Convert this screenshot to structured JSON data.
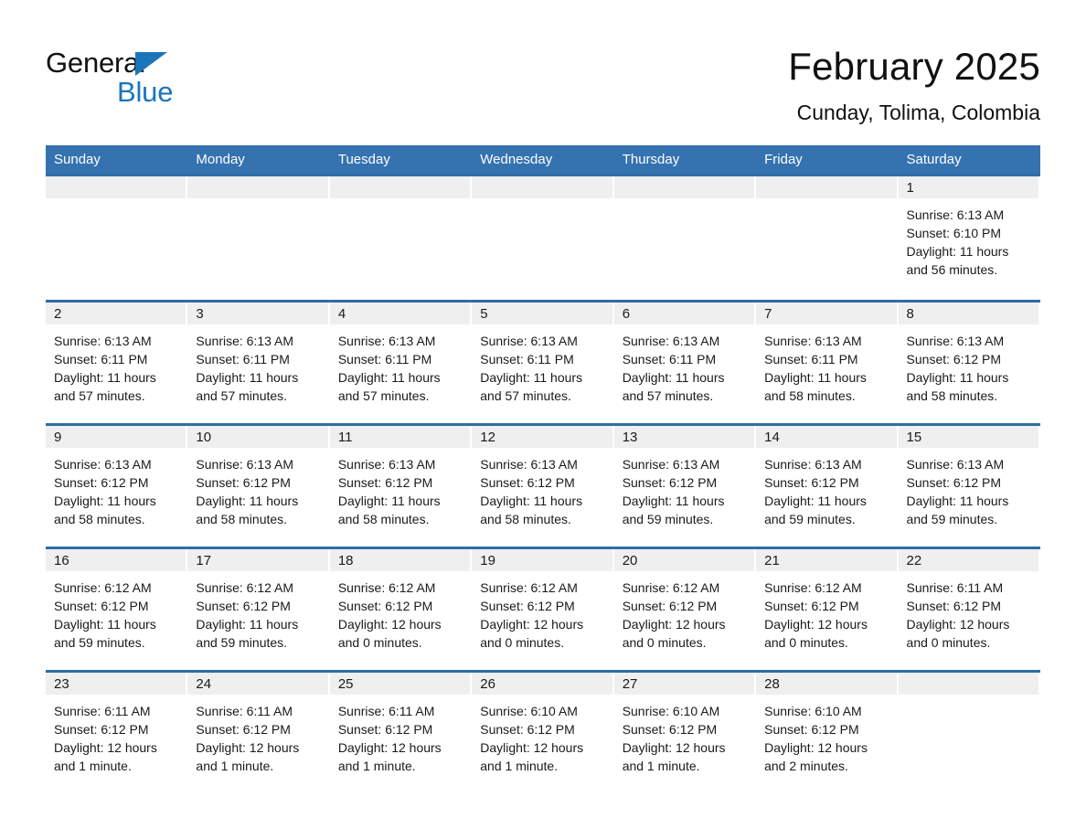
{
  "brand": {
    "name_dark": "General",
    "name_blue": "Blue",
    "triangle_color": "#1b75bb"
  },
  "header": {
    "title": "February 2025",
    "subtitle": "Cunday, Tolima, Colombia"
  },
  "theme": {
    "header_bar": "#3572b0",
    "row_divider": "#2e6da4",
    "daynum_band": "#efefef",
    "text": "#1a1a1a"
  },
  "calendar": {
    "weekday_headers": [
      "Sunday",
      "Monday",
      "Tuesday",
      "Wednesday",
      "Thursday",
      "Friday",
      "Saturday"
    ],
    "labels": {
      "sunrise": "Sunrise:",
      "sunset": "Sunset:",
      "daylight": "Daylight:"
    },
    "weeks": [
      [
        {
          "day": "",
          "empty": true
        },
        {
          "day": "",
          "empty": true
        },
        {
          "day": "",
          "empty": true
        },
        {
          "day": "",
          "empty": true
        },
        {
          "day": "",
          "empty": true
        },
        {
          "day": "",
          "empty": true
        },
        {
          "day": "1",
          "sunrise": "Sunrise: 6:13 AM",
          "sunset": "Sunset: 6:10 PM",
          "daylight": "Daylight: 11 hours and 56 minutes."
        }
      ],
      [
        {
          "day": "2",
          "sunrise": "Sunrise: 6:13 AM",
          "sunset": "Sunset: 6:11 PM",
          "daylight": "Daylight: 11 hours and 57 minutes."
        },
        {
          "day": "3",
          "sunrise": "Sunrise: 6:13 AM",
          "sunset": "Sunset: 6:11 PM",
          "daylight": "Daylight: 11 hours and 57 minutes."
        },
        {
          "day": "4",
          "sunrise": "Sunrise: 6:13 AM",
          "sunset": "Sunset: 6:11 PM",
          "daylight": "Daylight: 11 hours and 57 minutes."
        },
        {
          "day": "5",
          "sunrise": "Sunrise: 6:13 AM",
          "sunset": "Sunset: 6:11 PM",
          "daylight": "Daylight: 11 hours and 57 minutes."
        },
        {
          "day": "6",
          "sunrise": "Sunrise: 6:13 AM",
          "sunset": "Sunset: 6:11 PM",
          "daylight": "Daylight: 11 hours and 57 minutes."
        },
        {
          "day": "7",
          "sunrise": "Sunrise: 6:13 AM",
          "sunset": "Sunset: 6:11 PM",
          "daylight": "Daylight: 11 hours and 58 minutes."
        },
        {
          "day": "8",
          "sunrise": "Sunrise: 6:13 AM",
          "sunset": "Sunset: 6:12 PM",
          "daylight": "Daylight: 11 hours and 58 minutes."
        }
      ],
      [
        {
          "day": "9",
          "sunrise": "Sunrise: 6:13 AM",
          "sunset": "Sunset: 6:12 PM",
          "daylight": "Daylight: 11 hours and 58 minutes."
        },
        {
          "day": "10",
          "sunrise": "Sunrise: 6:13 AM",
          "sunset": "Sunset: 6:12 PM",
          "daylight": "Daylight: 11 hours and 58 minutes."
        },
        {
          "day": "11",
          "sunrise": "Sunrise: 6:13 AM",
          "sunset": "Sunset: 6:12 PM",
          "daylight": "Daylight: 11 hours and 58 minutes."
        },
        {
          "day": "12",
          "sunrise": "Sunrise: 6:13 AM",
          "sunset": "Sunset: 6:12 PM",
          "daylight": "Daylight: 11 hours and 58 minutes."
        },
        {
          "day": "13",
          "sunrise": "Sunrise: 6:13 AM",
          "sunset": "Sunset: 6:12 PM",
          "daylight": "Daylight: 11 hours and 59 minutes."
        },
        {
          "day": "14",
          "sunrise": "Sunrise: 6:13 AM",
          "sunset": "Sunset: 6:12 PM",
          "daylight": "Daylight: 11 hours and 59 minutes."
        },
        {
          "day": "15",
          "sunrise": "Sunrise: 6:13 AM",
          "sunset": "Sunset: 6:12 PM",
          "daylight": "Daylight: 11 hours and 59 minutes."
        }
      ],
      [
        {
          "day": "16",
          "sunrise": "Sunrise: 6:12 AM",
          "sunset": "Sunset: 6:12 PM",
          "daylight": "Daylight: 11 hours and 59 minutes."
        },
        {
          "day": "17",
          "sunrise": "Sunrise: 6:12 AM",
          "sunset": "Sunset: 6:12 PM",
          "daylight": "Daylight: 11 hours and 59 minutes."
        },
        {
          "day": "18",
          "sunrise": "Sunrise: 6:12 AM",
          "sunset": "Sunset: 6:12 PM",
          "daylight": "Daylight: 12 hours and 0 minutes."
        },
        {
          "day": "19",
          "sunrise": "Sunrise: 6:12 AM",
          "sunset": "Sunset: 6:12 PM",
          "daylight": "Daylight: 12 hours and 0 minutes."
        },
        {
          "day": "20",
          "sunrise": "Sunrise: 6:12 AM",
          "sunset": "Sunset: 6:12 PM",
          "daylight": "Daylight: 12 hours and 0 minutes."
        },
        {
          "day": "21",
          "sunrise": "Sunrise: 6:12 AM",
          "sunset": "Sunset: 6:12 PM",
          "daylight": "Daylight: 12 hours and 0 minutes."
        },
        {
          "day": "22",
          "sunrise": "Sunrise: 6:11 AM",
          "sunset": "Sunset: 6:12 PM",
          "daylight": "Daylight: 12 hours and 0 minutes."
        }
      ],
      [
        {
          "day": "23",
          "sunrise": "Sunrise: 6:11 AM",
          "sunset": "Sunset: 6:12 PM",
          "daylight": "Daylight: 12 hours and 1 minute."
        },
        {
          "day": "24",
          "sunrise": "Sunrise: 6:11 AM",
          "sunset": "Sunset: 6:12 PM",
          "daylight": "Daylight: 12 hours and 1 minute."
        },
        {
          "day": "25",
          "sunrise": "Sunrise: 6:11 AM",
          "sunset": "Sunset: 6:12 PM",
          "daylight": "Daylight: 12 hours and 1 minute."
        },
        {
          "day": "26",
          "sunrise": "Sunrise: 6:10 AM",
          "sunset": "Sunset: 6:12 PM",
          "daylight": "Daylight: 12 hours and 1 minute."
        },
        {
          "day": "27",
          "sunrise": "Sunrise: 6:10 AM",
          "sunset": "Sunset: 6:12 PM",
          "daylight": "Daylight: 12 hours and 1 minute."
        },
        {
          "day": "28",
          "sunrise": "Sunrise: 6:10 AM",
          "sunset": "Sunset: 6:12 PM",
          "daylight": "Daylight: 12 hours and 2 minutes."
        },
        {
          "day": "",
          "empty": true
        }
      ]
    ]
  }
}
